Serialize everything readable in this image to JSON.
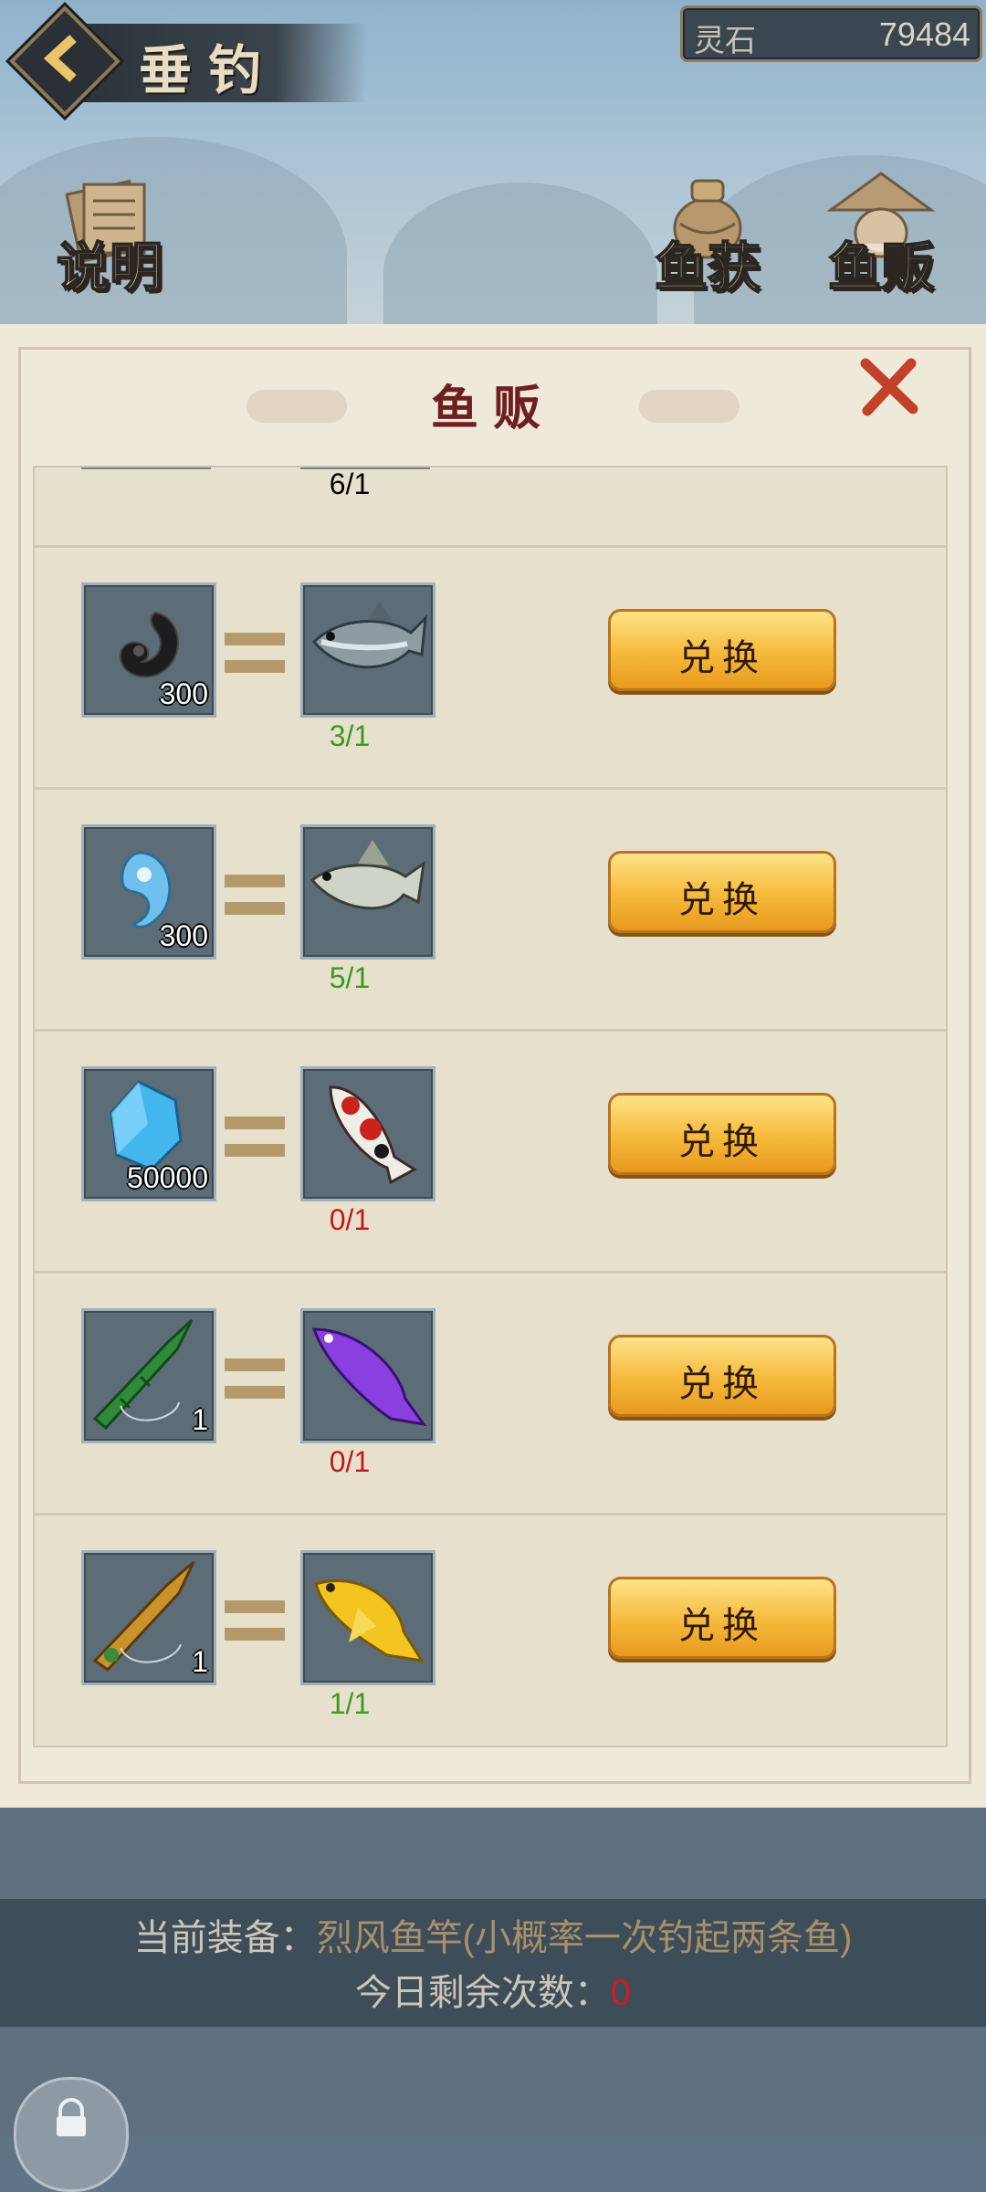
{
  "header": {
    "title": "垂钓",
    "back_icon": "chevron-left-icon",
    "currency_label": "灵石",
    "currency_value": "79484"
  },
  "corner_buttons": {
    "help_label": "说明",
    "catch_label": "鱼获",
    "vendor_label": "鱼贩"
  },
  "panel": {
    "title": "鱼贩",
    "close_icon": "close-x-icon"
  },
  "partial_row": {
    "count": "6/1",
    "status": "ok"
  },
  "trades": [
    {
      "item_icon": "black-magatama-icon",
      "item_qty": "300",
      "fish_icon": "grey-bass-fish-icon",
      "count": "3/1",
      "status": "ok",
      "button": "兑换"
    },
    {
      "item_icon": "blue-magatama-icon",
      "item_qty": "300",
      "fish_icon": "white-perch-fish-icon",
      "count": "5/1",
      "status": "ok",
      "button": "兑换"
    },
    {
      "item_icon": "blue-crystal-icon",
      "item_qty": "50000",
      "fish_icon": "koi-fish-icon",
      "count": "0/1",
      "status": "no",
      "button": "兑换"
    },
    {
      "item_icon": "bamboo-rod-icon",
      "item_qty": "1",
      "fish_icon": "purple-arowana-icon",
      "count": "0/1",
      "status": "no",
      "button": "兑换"
    },
    {
      "item_icon": "golden-rod-icon",
      "item_qty": "1",
      "fish_icon": "golden-arowana-icon",
      "count": "1/1",
      "status": "ok",
      "button": "兑换"
    }
  ],
  "footer": {
    "equip_label": "当前装备：",
    "equip_value": "烈风鱼竿(小概率一次钓起两条鱼)",
    "remaining_label": "今日剩余次数：",
    "remaining_value": "0",
    "lock_icon": "lock-icon"
  },
  "colors": {
    "ok": "#3a9a1f",
    "no": "#c41818",
    "accent": "#f6b93a"
  }
}
